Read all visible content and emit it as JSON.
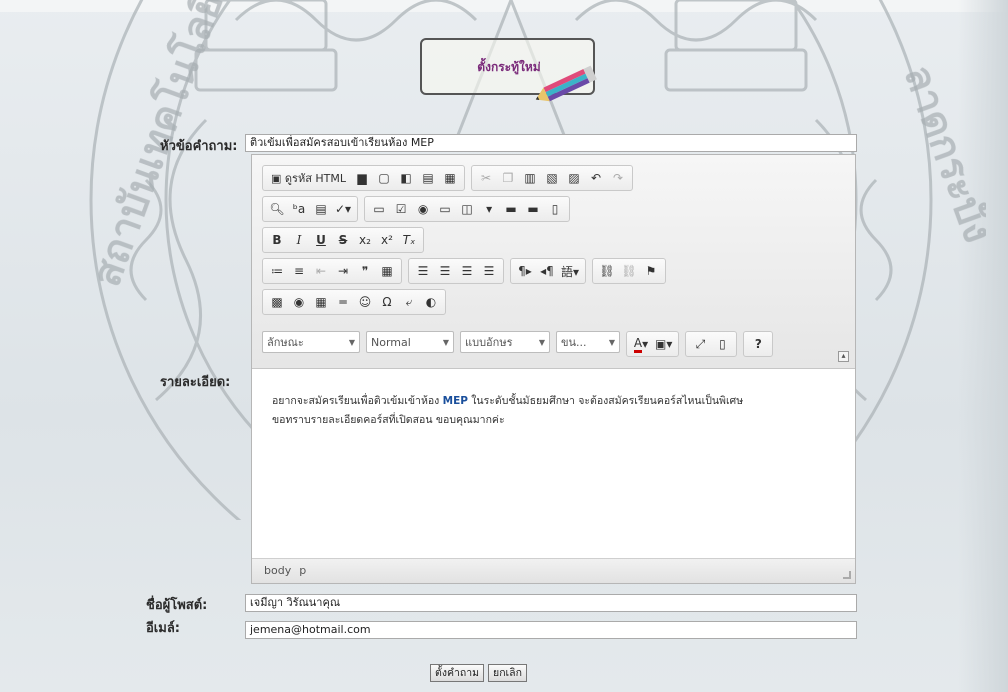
{
  "header": {
    "logo_text": "ตั้งกระทู้ใหม่"
  },
  "form": {
    "subject_label": "หัวข้อคำถาม:",
    "subject_value": "ติวเข้มเพื่อสมัครสอบเข้าเรียนห้อง MEP",
    "detail_label": "รายละเอียด:",
    "poster_label": "ชื่อผู้โพสต์:",
    "poster_value": "เจมีญา วิรัณนาคุณ",
    "email_label": "อีเมล์:",
    "email_value": "jemena@hotmail.com"
  },
  "editor": {
    "toolbar": {
      "source_label": "ดูรหัส HTML",
      "style_combo": "ลักษณะ",
      "format_combo": "Normal",
      "font_combo": "แบบอักษร",
      "size_combo": "ขน...",
      "help_label": "?"
    },
    "body": {
      "line1_a": "อยากจะสมัครเรียนเพื่อติวเข้มเข้าห้อง ",
      "line1_hl": "MEP",
      "line1_b": " ในระดับชั้นมัธยมศึกษา จะต้องสมัครเรียนคอร์สไหนเป็นพิเศษ",
      "line2": "ขอทราบรายละเอียดคอร์สที่เปิดสอน ขอบคุณมากค่ะ"
    },
    "status": {
      "path1": "body",
      "path2": "p"
    }
  },
  "buttons": {
    "submit": "ตั้งคำถาม",
    "cancel": "ยกเลิก"
  },
  "colors": {
    "watermark": "#b8bec2",
    "logo_text": "#7a2a7a",
    "link": "#1a4f9c"
  }
}
